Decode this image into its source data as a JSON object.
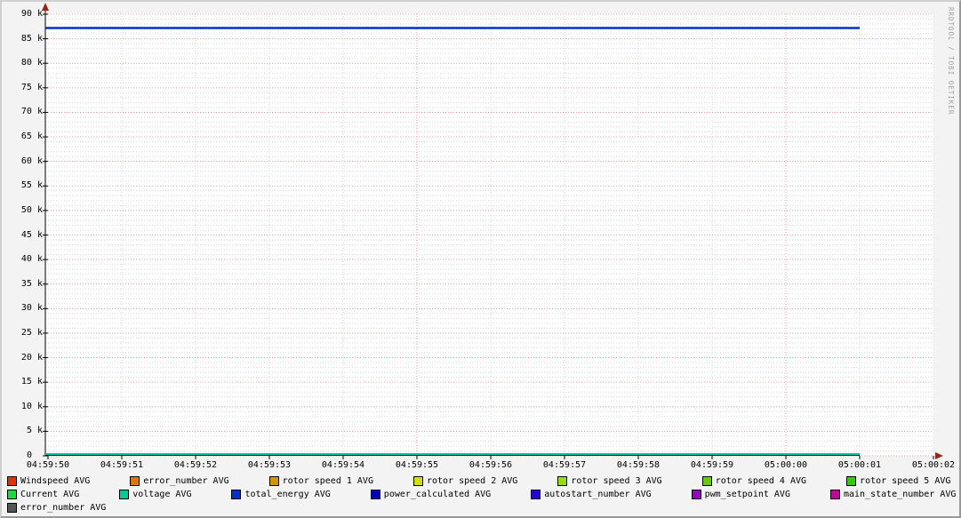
{
  "watermark": "RRDTOOL / TOBI OETIKER",
  "chart_data": {
    "type": "line",
    "title": "",
    "xlabel": "",
    "ylabel": "",
    "x_range": [
      "04:59:50",
      "05:00:02"
    ],
    "x_ticks": [
      {
        "label": "04:59:50",
        "major": false
      },
      {
        "label": "04:59:51",
        "major": false
      },
      {
        "label": "04:59:52",
        "major": false
      },
      {
        "label": "04:59:53",
        "major": false
      },
      {
        "label": "04:59:54",
        "major": false
      },
      {
        "label": "04:59:55",
        "major": true
      },
      {
        "label": "04:59:56",
        "major": false
      },
      {
        "label": "04:59:57",
        "major": false
      },
      {
        "label": "04:59:58",
        "major": false
      },
      {
        "label": "04:59:59",
        "major": false
      },
      {
        "label": "05:00:00",
        "major": true
      },
      {
        "label": "05:00:01",
        "major": false
      },
      {
        "label": "05:00:02",
        "major": false
      }
    ],
    "ylim": [
      0,
      90000
    ],
    "y_minor_step": 1000,
    "y_major_step": 5000,
    "y_ticks": [
      {
        "value": 0,
        "label": "0  "
      },
      {
        "value": 5000,
        "label": "5 k"
      },
      {
        "value": 10000,
        "label": "10 k"
      },
      {
        "value": 15000,
        "label": "15 k"
      },
      {
        "value": 20000,
        "label": "20 k"
      },
      {
        "value": 25000,
        "label": "25 k"
      },
      {
        "value": 30000,
        "label": "30 k"
      },
      {
        "value": 35000,
        "label": "35 k"
      },
      {
        "value": 40000,
        "label": "40 k"
      },
      {
        "value": 45000,
        "label": "45 k"
      },
      {
        "value": 50000,
        "label": "50 k"
      },
      {
        "value": 55000,
        "label": "55 k"
      },
      {
        "value": 60000,
        "label": "60 k"
      },
      {
        "value": 65000,
        "label": "65 k"
      },
      {
        "value": 70000,
        "label": "70 k"
      },
      {
        "value": 75000,
        "label": "75 k"
      },
      {
        "value": 80000,
        "label": "80 k"
      },
      {
        "value": 85000,
        "label": "85 k"
      },
      {
        "value": 90000,
        "label": "90 k"
      }
    ],
    "data_start": "04:59:50",
    "data_end": "05:00:01",
    "data_end_index": 11,
    "series": [
      {
        "name": "power_calculated AVG",
        "color": "#0000BB",
        "value": 0,
        "width": 2
      },
      {
        "name": "voltage AVG",
        "color": "#00CC99",
        "value": 0,
        "width": 2
      },
      {
        "name": "total_energy AVG",
        "color": "#0033CC",
        "value": 87200,
        "width": 2.5
      }
    ],
    "grid": {
      "minor_color": "#D9D9D9",
      "major_color": "#F19E9E",
      "axis_color": "#000000",
      "arrow_color": "#96261B",
      "canvas_color": "#FFFFFF",
      "background_color": "#F3F3F3"
    },
    "legend_position": "bottom"
  },
  "legend": {
    "rows": [
      [
        {
          "label": "Windspeed AVG",
          "color": "#DD3500"
        },
        {
          "label": "error_number AVG",
          "color": "#DD7700"
        },
        {
          "label": "rotor speed 1 AVG",
          "color": "#CC9900"
        },
        {
          "label": "rotor speed 2 AVG",
          "color": "#D6DD00"
        },
        {
          "label": "rotor speed 3 AVG",
          "color": "#99DD00"
        },
        {
          "label": "rotor speed 4 AVG",
          "color": "#66CC00"
        },
        {
          "label": "rotor speed 5 AVG",
          "color": "#33CC00"
        }
      ],
      [
        {
          "label": "Current AVG",
          "color": "#17DD3A"
        },
        {
          "label": "voltage AVG",
          "color": "#00CC99"
        },
        {
          "label": "total_energy AVG",
          "color": "#0033CC"
        },
        {
          "label": "power_calculated AVG",
          "color": "#0000BB"
        },
        {
          "label": "autostart_number AVG",
          "color": "#2A00D0"
        },
        {
          "label": "pwm_setpoint AVG",
          "color": "#9900CC"
        },
        {
          "label": "main_state_number AVG",
          "color": "#CC0099"
        }
      ],
      [
        {
          "label": "error_number AVG",
          "color": "#555555"
        }
      ]
    ]
  }
}
